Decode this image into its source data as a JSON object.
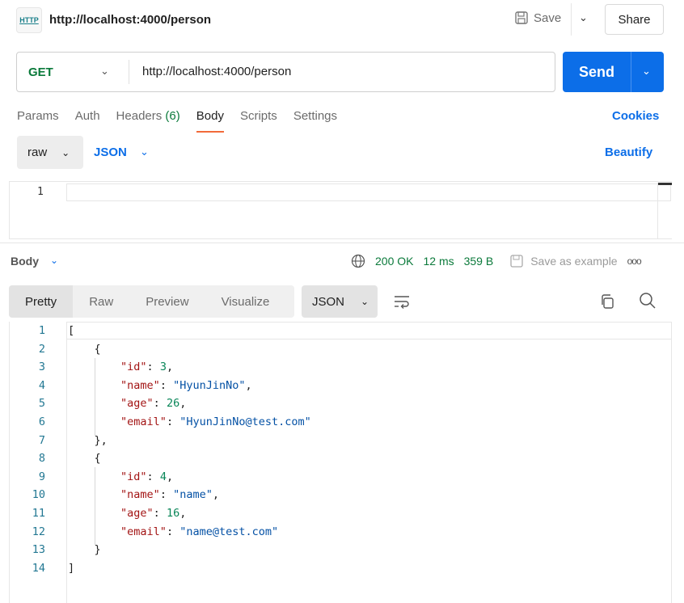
{
  "header": {
    "icon": "http-icon",
    "title": "http://localhost:4000/person",
    "save_label": "Save",
    "share_label": "Share"
  },
  "request": {
    "method": "GET",
    "url": "http://localhost:4000/person",
    "send_label": "Send"
  },
  "tabs": [
    {
      "label": "Params"
    },
    {
      "label": "Auth"
    },
    {
      "label": "Headers",
      "count": "(6)"
    },
    {
      "label": "Body",
      "active": true
    },
    {
      "label": "Scripts"
    },
    {
      "label": "Settings"
    }
  ],
  "cookies_label": "Cookies",
  "body_options": {
    "mode": "raw",
    "language": "JSON",
    "beautify_label": "Beautify"
  },
  "request_editor": {
    "line_numbers": [
      "1"
    ],
    "content": ""
  },
  "response": {
    "section_label": "Body",
    "status": "200 OK",
    "time": "12 ms",
    "size": "359 B",
    "save_example_label": "Save as example",
    "more_label": "ooo",
    "view_tabs": [
      "Pretty",
      "Raw",
      "Preview",
      "Visualize"
    ],
    "active_view": "Pretty",
    "format": "JSON",
    "lines": [
      [
        {
          "c": "p",
          "v": "["
        }
      ],
      [
        {
          "c": "p",
          "v": "    {"
        }
      ],
      [
        {
          "c": "p",
          "v": "        "
        },
        {
          "c": "k",
          "v": "\"id\""
        },
        {
          "c": "p",
          "v": ": "
        },
        {
          "c": "n",
          "v": "3"
        },
        {
          "c": "p",
          "v": ","
        }
      ],
      [
        {
          "c": "p",
          "v": "        "
        },
        {
          "c": "k",
          "v": "\"name\""
        },
        {
          "c": "p",
          "v": ": "
        },
        {
          "c": "s",
          "v": "\"HyunJinNo\""
        },
        {
          "c": "p",
          "v": ","
        }
      ],
      [
        {
          "c": "p",
          "v": "        "
        },
        {
          "c": "k",
          "v": "\"age\""
        },
        {
          "c": "p",
          "v": ": "
        },
        {
          "c": "n",
          "v": "26"
        },
        {
          "c": "p",
          "v": ","
        }
      ],
      [
        {
          "c": "p",
          "v": "        "
        },
        {
          "c": "k",
          "v": "\"email\""
        },
        {
          "c": "p",
          "v": ": "
        },
        {
          "c": "s",
          "v": "\"HyunJinNo@test.com\""
        }
      ],
      [
        {
          "c": "p",
          "v": "    },"
        }
      ],
      [
        {
          "c": "p",
          "v": "    {"
        }
      ],
      [
        {
          "c": "p",
          "v": "        "
        },
        {
          "c": "k",
          "v": "\"id\""
        },
        {
          "c": "p",
          "v": ": "
        },
        {
          "c": "n",
          "v": "4"
        },
        {
          "c": "p",
          "v": ","
        }
      ],
      [
        {
          "c": "p",
          "v": "        "
        },
        {
          "c": "k",
          "v": "\"name\""
        },
        {
          "c": "p",
          "v": ": "
        },
        {
          "c": "s",
          "v": "\"name\""
        },
        {
          "c": "p",
          "v": ","
        }
      ],
      [
        {
          "c": "p",
          "v": "        "
        },
        {
          "c": "k",
          "v": "\"age\""
        },
        {
          "c": "p",
          "v": ": "
        },
        {
          "c": "n",
          "v": "16"
        },
        {
          "c": "p",
          "v": ","
        }
      ],
      [
        {
          "c": "p",
          "v": "        "
        },
        {
          "c": "k",
          "v": "\"email\""
        },
        {
          "c": "p",
          "v": ": "
        },
        {
          "c": "s",
          "v": "\"name@test.com\""
        }
      ],
      [
        {
          "c": "p",
          "v": "    }"
        }
      ],
      [
        {
          "c": "p",
          "v": "]"
        }
      ]
    ]
  },
  "colors": {
    "accent": "#0c6ee8",
    "method_get": "#0b7a3b",
    "active_tab_underline": "#f26b3a",
    "json_key": "#a31515",
    "json_number": "#098658",
    "json_string": "#0451a5"
  }
}
